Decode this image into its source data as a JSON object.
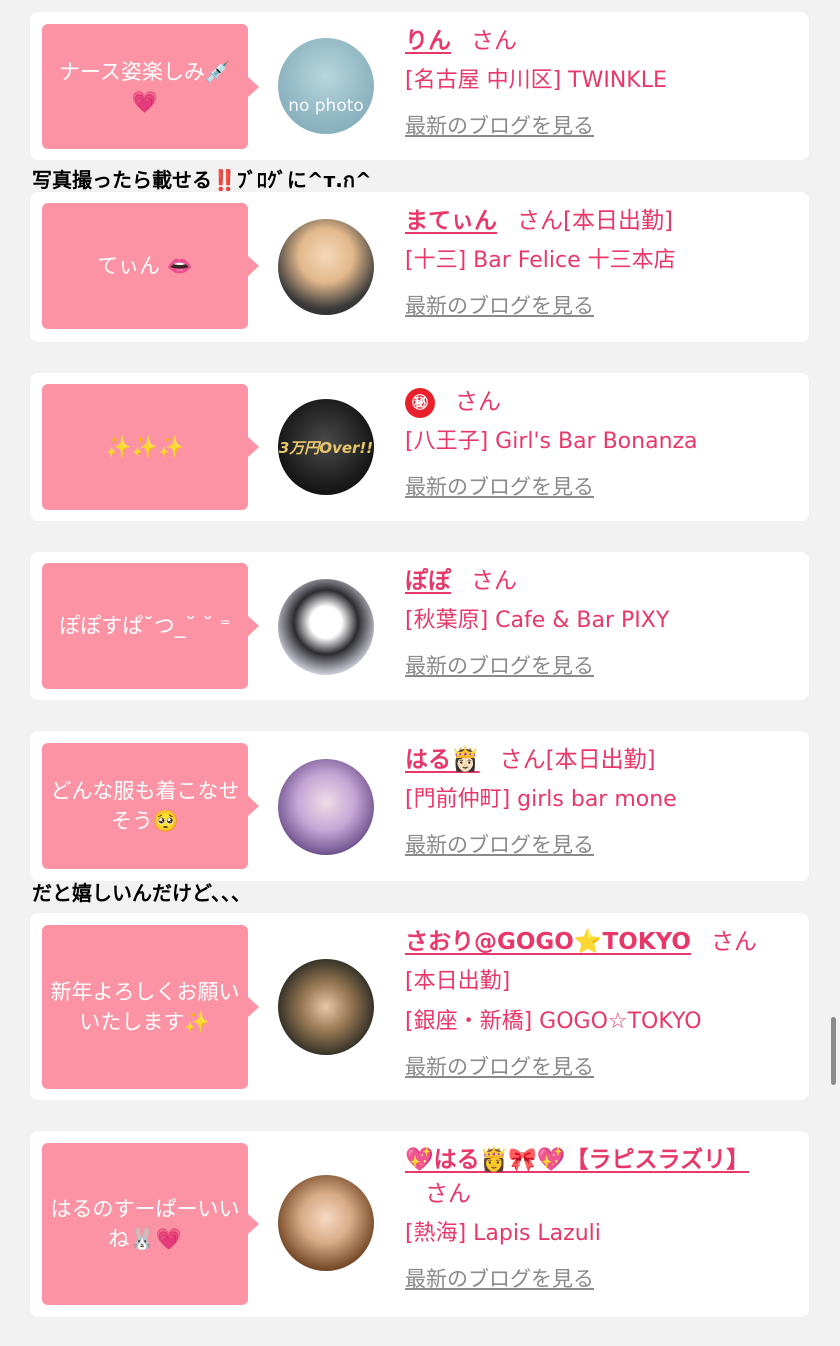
{
  "blog_link_label": "最新のブログを見る",
  "san_label": "さん",
  "captions": {
    "caption_1": "写真撮ったら載せる‼️ﾌﾞﾛｸﾞに^т.ก^",
    "caption_2": "だと嬉しいんだけど、、、"
  },
  "cards": [
    {
      "message": "ナース姿楽しみ💉💗",
      "name": "りん",
      "status": "",
      "shop": "[名古屋 中川区] TWINKLE",
      "avatar_text": "no photo"
    },
    {
      "message": "てぃん 👄",
      "name": "まてぃん",
      "status": "[本日出勤]",
      "shop": "[十三] Bar Felice 十三本店",
      "avatar_text": ""
    },
    {
      "message": "✨✨✨",
      "name": "㊙",
      "status": "",
      "shop": "[八王子] Girl's Bar Bonanza",
      "avatar_text": "3万円Over!!"
    },
    {
      "message": "ぽぽすぱ˘つ_˘ ˘ ⁼",
      "name": "ぽぽ",
      "status": "",
      "shop": "[秋葉原] Cafe & Bar PIXY",
      "avatar_text": ""
    },
    {
      "message": "どんな服も着こなせそう🥺",
      "name": "はる👸🏻",
      "status": "[本日出勤]",
      "shop": "[門前仲町] girls bar mone",
      "avatar_text": ""
    },
    {
      "message": "新年よろしくお願いいたします✨",
      "name": "さおり@GOGO⭐TOKYO",
      "status": "[本日出勤]",
      "shop": "[銀座・新橋] GOGO☆TOKYO",
      "avatar_text": ""
    },
    {
      "message": "はるのすーぱーいいね🐰💗",
      "name": "💖はる👸🎀💖【ラピスラズリ】",
      "status": "",
      "shop": "[熱海] Lapis Lazuli",
      "avatar_text": ""
    }
  ],
  "colors": {
    "bubble": "#fc93a4",
    "name": "#e8386a",
    "link_gray": "#8a8a8a",
    "background": "#f2f2f2"
  }
}
